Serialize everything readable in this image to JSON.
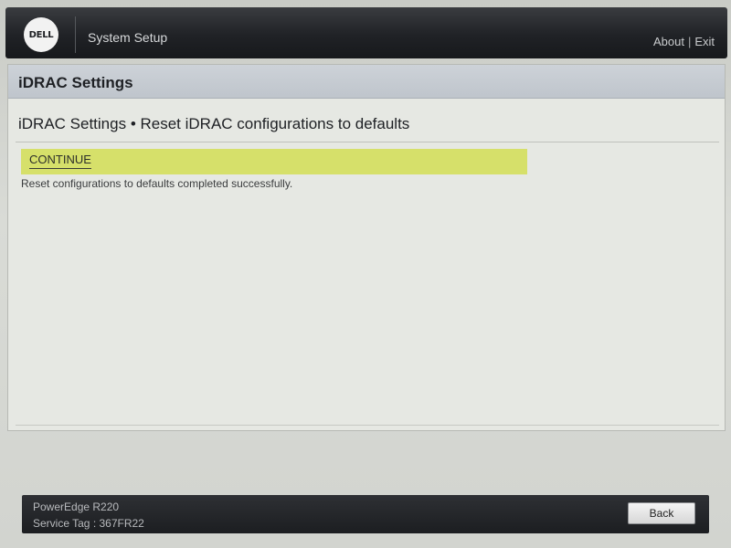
{
  "header": {
    "logo_text": "DELL",
    "app_title": "System Setup",
    "links": {
      "about": "About",
      "separator": "|",
      "exit": "Exit"
    }
  },
  "panel": {
    "title": "iDRAC Settings",
    "subtitle": "iDRAC Settings • Reset iDRAC configurations to defaults",
    "continue_label": "CONTINUE",
    "status_message": "Reset configurations to defaults completed successfully."
  },
  "footer": {
    "model": "PowerEdge R220",
    "service_tag": "Service Tag : 367FR22",
    "back_label": "Back"
  },
  "colors": {
    "header_bg": "#202226",
    "panel_header_bg": "#c6ccd2",
    "highlight_row": "#d6e06a",
    "footer_bg": "#1c1e21"
  }
}
